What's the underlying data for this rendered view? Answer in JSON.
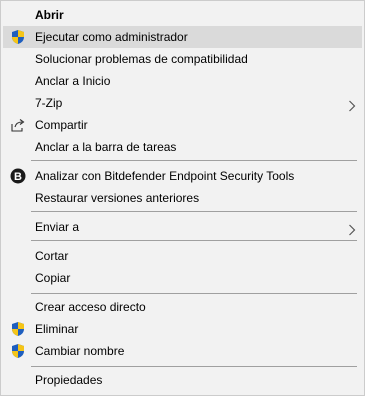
{
  "menu": {
    "items": [
      {
        "label": "Abrir",
        "bold": true,
        "icon": null,
        "submenu": false
      },
      {
        "label": "Ejecutar como administrador",
        "bold": false,
        "icon": "uac-shield-icon",
        "submenu": false,
        "highlighted": true
      },
      {
        "label": "Solucionar problemas de compatibilidad",
        "bold": false,
        "icon": null,
        "submenu": false
      },
      {
        "label": "Anclar a Inicio",
        "bold": false,
        "icon": null,
        "submenu": false
      },
      {
        "label": "7-Zip",
        "bold": false,
        "icon": null,
        "submenu": true
      },
      {
        "label": "Compartir",
        "bold": false,
        "icon": "share-icon",
        "submenu": false
      },
      {
        "label": "Anclar a la barra de tareas",
        "bold": false,
        "icon": null,
        "submenu": false
      },
      {
        "label": "Analizar con Bitdefender Endpoint Security Tools",
        "bold": false,
        "icon": "bitdefender-icon",
        "submenu": false
      },
      {
        "label": "Restaurar versiones anteriores",
        "bold": false,
        "icon": null,
        "submenu": false
      },
      {
        "label": "Enviar a",
        "bold": false,
        "icon": null,
        "submenu": true
      },
      {
        "label": "Cortar",
        "bold": false,
        "icon": null,
        "submenu": false
      },
      {
        "label": "Copiar",
        "bold": false,
        "icon": null,
        "submenu": false
      },
      {
        "label": "Crear acceso directo",
        "bold": false,
        "icon": null,
        "submenu": false
      },
      {
        "label": "Eliminar",
        "bold": false,
        "icon": "uac-shield-icon",
        "submenu": false
      },
      {
        "label": "Cambiar nombre",
        "bold": false,
        "icon": "uac-shield-icon",
        "submenu": false
      },
      {
        "label": "Propiedades",
        "bold": false,
        "icon": null,
        "submenu": false
      }
    ]
  },
  "colors": {
    "menu_background": "#f2f2f2",
    "highlight_background": "#dadada",
    "separator": "#a0a0a0",
    "shield_blue": "#1f5fbf",
    "shield_yellow": "#f5c518"
  }
}
